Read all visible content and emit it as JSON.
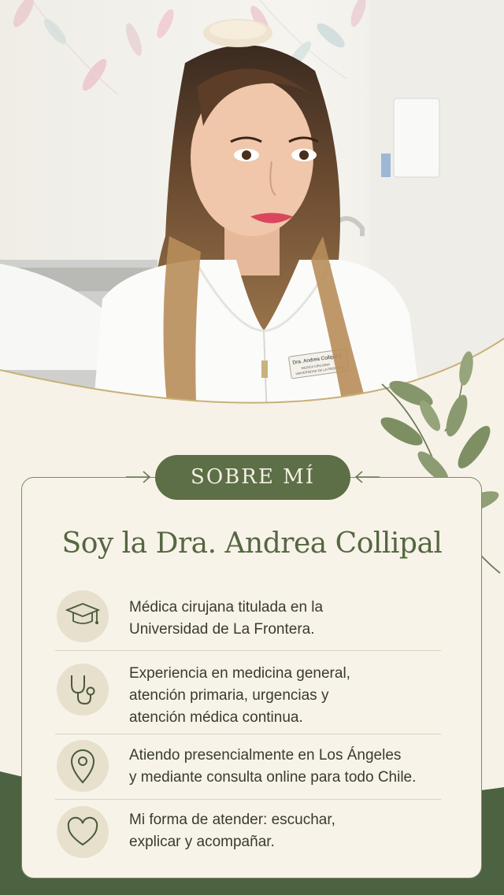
{
  "photo": {
    "badge_line1": "Dra. Andrea Collipal E.",
    "badge_line2": "MEDICA CIRUJANA",
    "badge_line3": "UNIVERSIDAD DE LA FRONTERA"
  },
  "section_title": "SOBRE MÍ",
  "headline": "Soy la Dra. Andrea Collipal",
  "items": [
    {
      "icon": "graduation-cap-icon",
      "line1": "Médica cirujana titulada en la",
      "line2": "Universidad de La Frontera.",
      "line3": ""
    },
    {
      "icon": "stethoscope-icon",
      "line1": "Experiencia en medicina general,",
      "line2": "atención primaria, urgencias y",
      "line3": "atención médica continua."
    },
    {
      "icon": "location-pin-icon",
      "line1": "Atiendo presencialmente en Los Ángeles",
      "line2": "y mediante consulta online para todo Chile.",
      "line3": ""
    },
    {
      "icon": "heart-icon",
      "line1": "Mi forma de atender: escuchar,",
      "line2": "explicar y acompañar.",
      "line3": ""
    }
  ],
  "colors": {
    "accent_green": "#5c6f46",
    "background_cream": "#f7f2e8",
    "icon_circle": "#e6e0cc"
  }
}
